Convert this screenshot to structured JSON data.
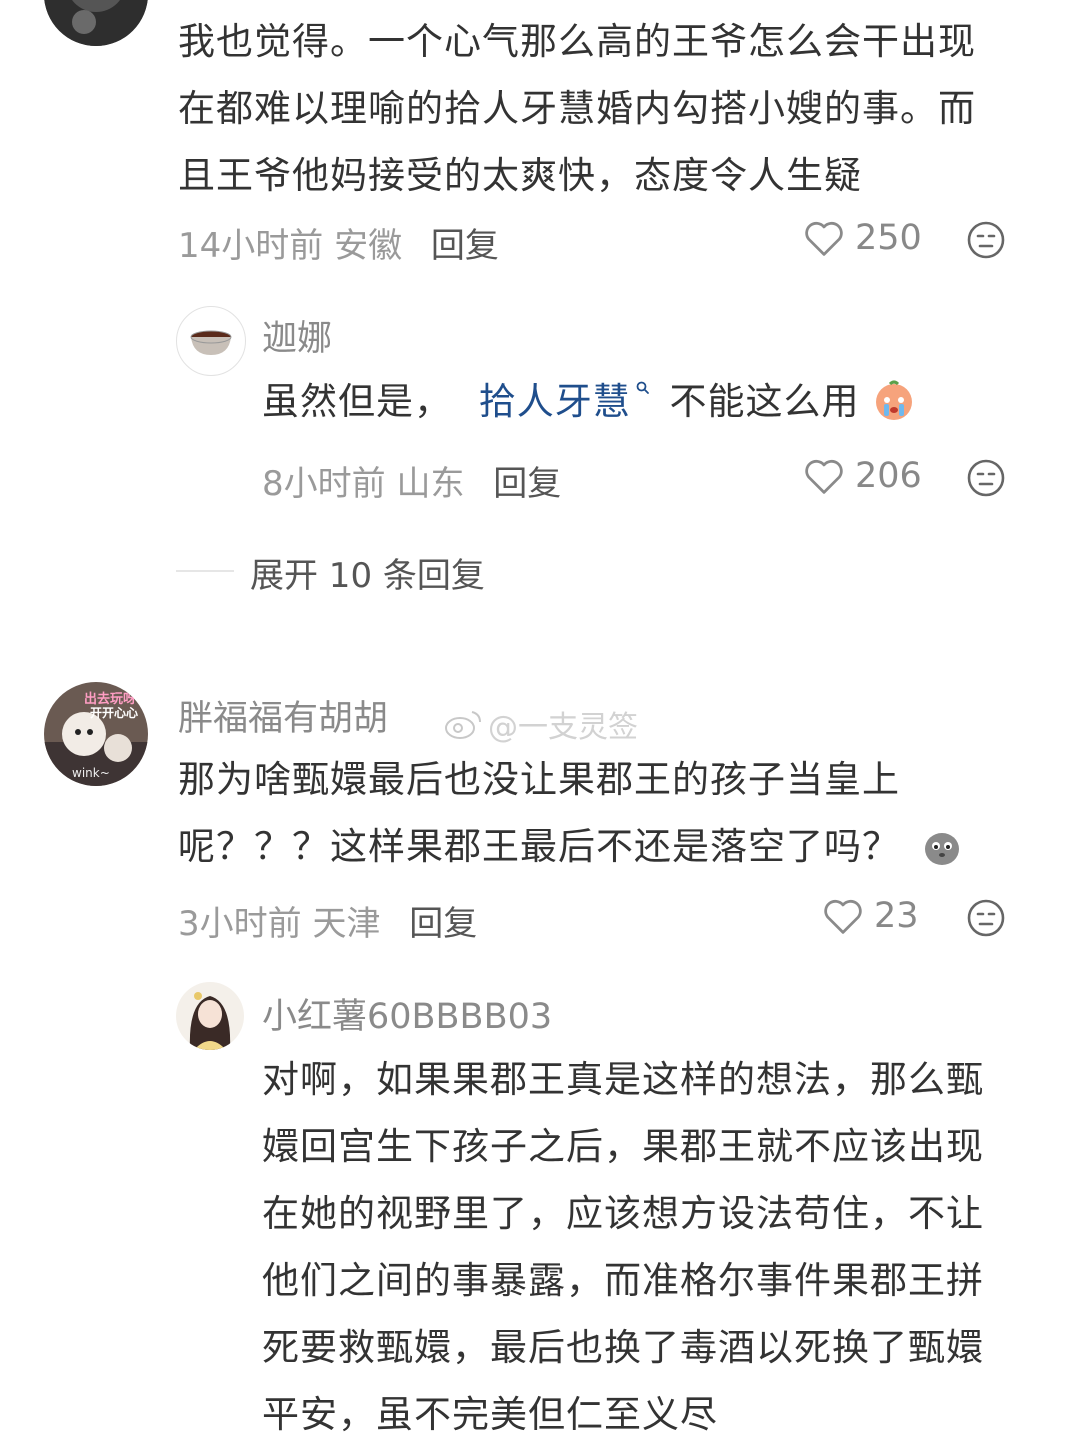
{
  "comments": [
    {
      "text_lines": [
        "我也觉得。一个心气那么高的王爷怎么会干出现",
        "在都难以理喻的拾人牙慧婚内勾搭小嫂的事。而",
        "且王爷他妈接受的太爽快，态度令人生疑"
      ],
      "time": "14小时前",
      "location": "安徽",
      "reply_label": "回复",
      "likes": "250"
    },
    {
      "author": "迦娜",
      "text_before": "虽然但是，",
      "search_tag": "拾人牙慧",
      "text_after": "不能这么用",
      "time": "8小时前",
      "location": "山东",
      "reply_label": "回复",
      "likes": "206"
    },
    {
      "expand_label": "展开 10 条回复"
    },
    {
      "author": "胖福福有胡胡",
      "watermark": "@一支灵签",
      "avatar_text_top": "出去玩呀",
      "avatar_text_mid": "开开心心",
      "avatar_text_bottom": "wink~",
      "text_lines": [
        "那为啥甄嬛最后也没让果郡王的孩子当皇上",
        "呢？？？这样果郡王最后不还是落空了吗？"
      ],
      "time": "3小时前",
      "location": "天津",
      "reply_label": "回复",
      "likes": "23"
    },
    {
      "author": "小红薯60BBBB03",
      "text_lines": [
        "对啊，如果果郡王真是这样的想法，那么甄",
        "嬛回宫生下孩子之后，果郡王就不应该出现",
        "在她的视野里了，应该想方设法苟住，不让",
        "他们之间的事暴露，而准格尔事件果郡王拼",
        "死要救甄嬛，最后也换了毒酒以死换了甄嬛",
        "平安，虽不完美但仁至义尽"
      ]
    }
  ],
  "icons": {
    "like": "heart-outline-icon",
    "react": "meh-face-icon",
    "search": "search-icon"
  }
}
